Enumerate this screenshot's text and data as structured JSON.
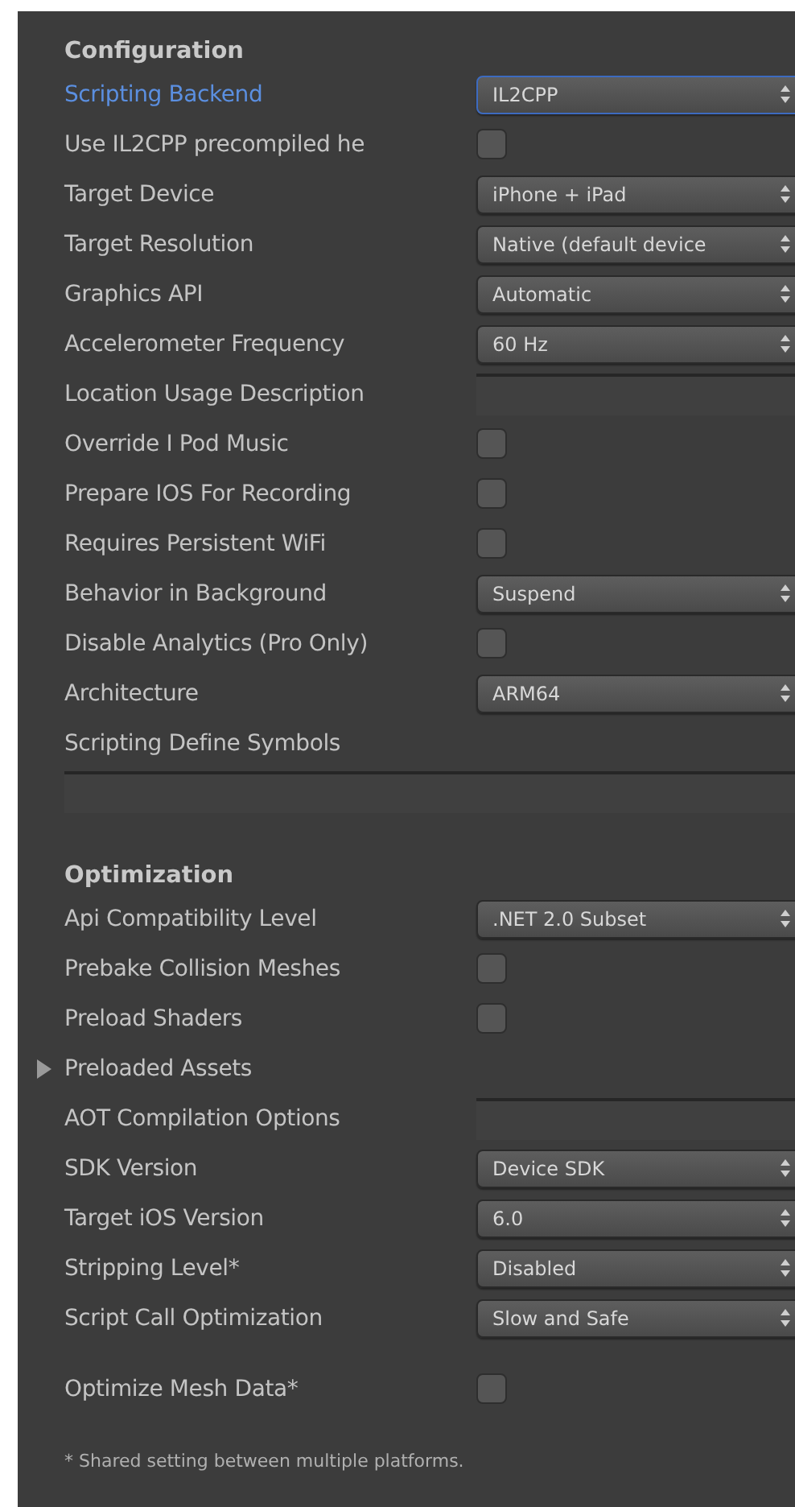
{
  "sections": [
    {
      "title": "Configuration",
      "rows": [
        {
          "kind": "dropdown",
          "label": "Scripting Backend",
          "value": "IL2CPP",
          "focused": true
        },
        {
          "kind": "checkbox",
          "label": "Use IL2CPP precompiled he",
          "checked": false
        },
        {
          "kind": "dropdown",
          "label": "Target Device",
          "value": "iPhone + iPad"
        },
        {
          "kind": "dropdown",
          "label": "Target Resolution",
          "value": "Native (default device"
        },
        {
          "kind": "dropdown",
          "label": "Graphics API",
          "value": "Automatic"
        },
        {
          "kind": "dropdown",
          "label": "Accelerometer Frequency",
          "value": "60 Hz"
        },
        {
          "kind": "text",
          "label": "Location Usage Description"
        },
        {
          "kind": "checkbox",
          "label": "Override I Pod Music",
          "checked": false
        },
        {
          "kind": "checkbox",
          "label": "Prepare IOS For Recording",
          "checked": false
        },
        {
          "kind": "checkbox",
          "label": "Requires Persistent WiFi",
          "checked": false
        },
        {
          "kind": "dropdown",
          "label": "Behavior in Background",
          "value": "Suspend"
        },
        {
          "kind": "checkbox",
          "label": "Disable Analytics (Pro Only)",
          "checked": false
        },
        {
          "kind": "dropdown",
          "label": "Architecture",
          "value": "ARM64"
        },
        {
          "kind": "widetext",
          "label": "Scripting Define Symbols"
        }
      ]
    },
    {
      "title": "Optimization",
      "rows": [
        {
          "kind": "dropdown",
          "label": "Api Compatibility Level",
          "value": ".NET 2.0 Subset"
        },
        {
          "kind": "checkbox",
          "label": "Prebake Collision Meshes",
          "checked": false
        },
        {
          "kind": "checkbox",
          "label": "Preload Shaders",
          "checked": false
        },
        {
          "kind": "foldout",
          "label": "Preloaded Assets",
          "expanded": false
        },
        {
          "kind": "text",
          "label": "AOT Compilation Options"
        },
        {
          "kind": "dropdown",
          "label": "SDK Version",
          "value": "Device SDK"
        },
        {
          "kind": "dropdown",
          "label": "Target iOS Version",
          "value": "6.0"
        },
        {
          "kind": "dropdown",
          "label": "Stripping Level*",
          "value": "Disabled"
        },
        {
          "kind": "dropdown",
          "label": "Script Call Optimization",
          "value": "Slow and Safe"
        }
      ],
      "more_rows": [
        {
          "kind": "checkbox",
          "label": "Optimize Mesh Data*",
          "checked": false
        }
      ]
    }
  ],
  "footnote": "* Shared setting between multiple platforms."
}
